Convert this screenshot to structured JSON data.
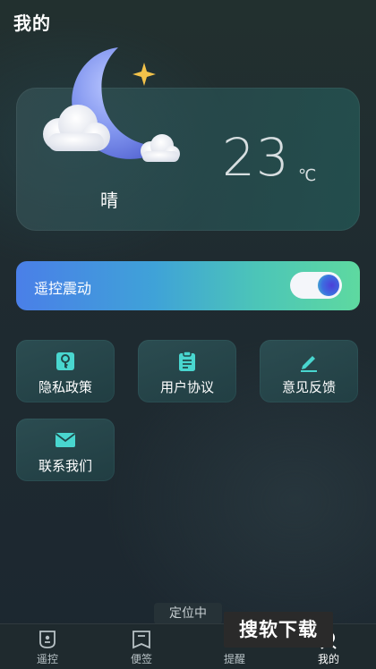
{
  "header": {
    "title": "我的"
  },
  "weather": {
    "condition": "晴",
    "temperature": "23",
    "unit": "℃"
  },
  "vibration": {
    "label": "遥控震动",
    "enabled": true
  },
  "menu": {
    "items": [
      {
        "label": "隐私政策",
        "icon": "privacy-key-icon"
      },
      {
        "label": "用户协议",
        "icon": "clipboard-icon"
      },
      {
        "label": "意见反馈",
        "icon": "pencil-icon"
      },
      {
        "label": "联系我们",
        "icon": "mail-icon"
      }
    ]
  },
  "location_status": "定位中",
  "tabbar": {
    "tabs": [
      {
        "label": "遥控",
        "icon": "remote-icon"
      },
      {
        "label": "便签",
        "icon": "note-icon"
      },
      {
        "label": "提醒",
        "icon": "bell-icon"
      },
      {
        "label": "我的",
        "icon": "profile-icon",
        "active": true
      }
    ]
  },
  "watermark": {
    "text": "搜软下载"
  },
  "colors": {
    "accent_start": "#4a7fe8",
    "accent_end": "#5ed9a0",
    "tile_icon": "#49d6cf"
  }
}
